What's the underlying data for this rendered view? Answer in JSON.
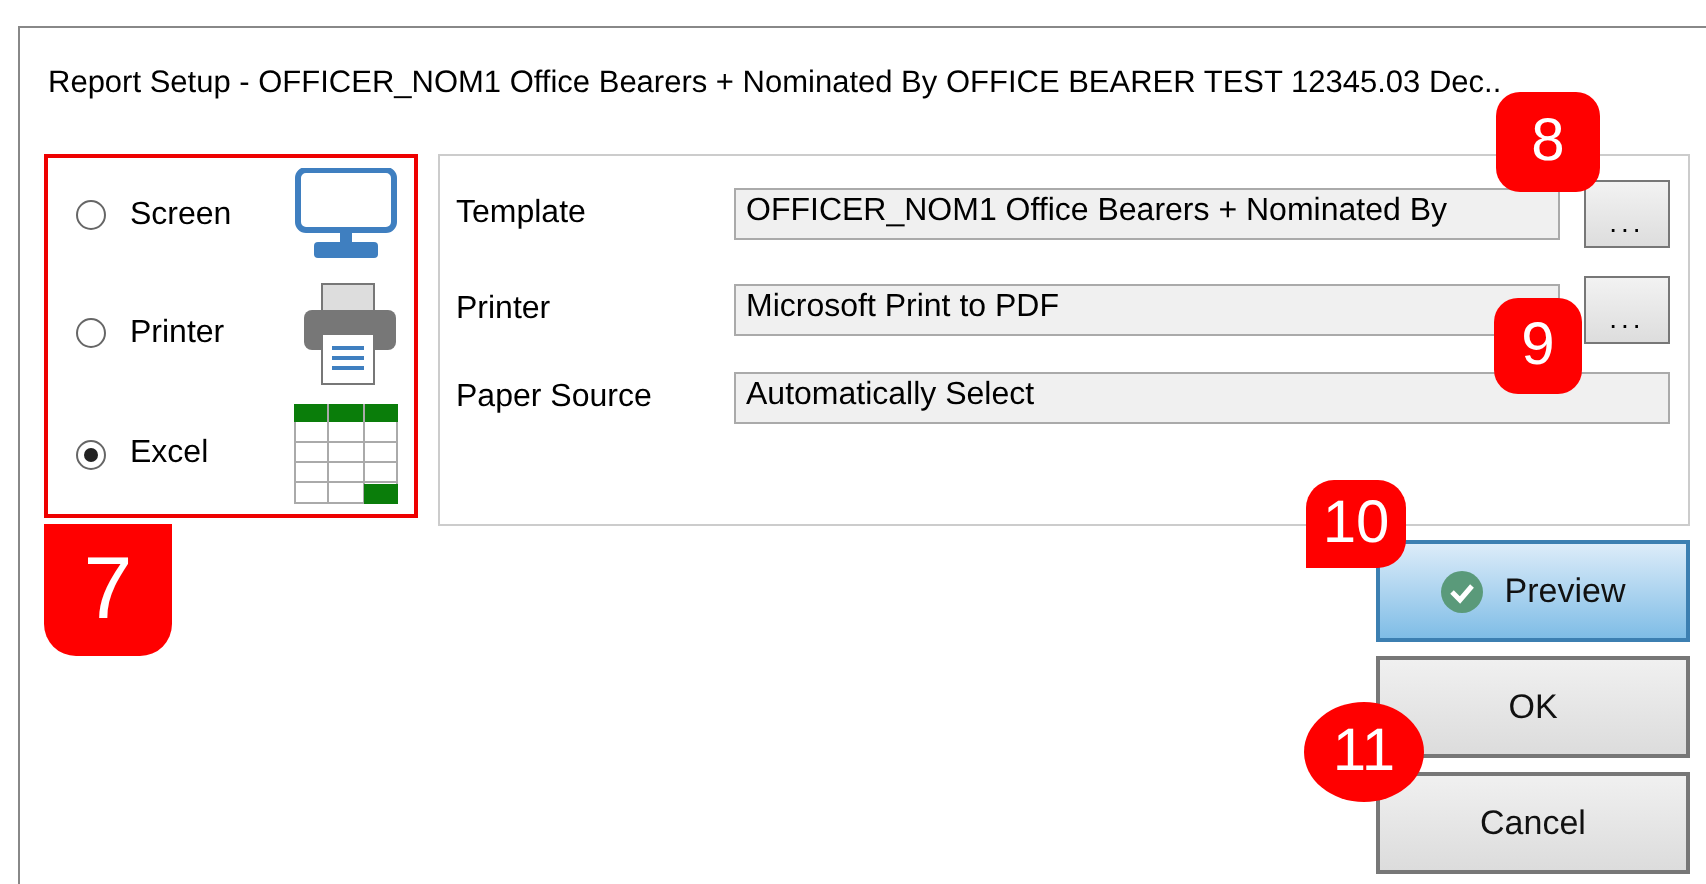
{
  "window": {
    "title": "Report Setup - OFFICER_NOM1 Office Bearers + Nominated By OFFICE BEARER TEST 12345.03 Dec.."
  },
  "outputs": [
    {
      "label": "Screen",
      "kind": "screen",
      "selected": false
    },
    {
      "label": "Printer",
      "kind": "printer",
      "selected": false
    },
    {
      "label": "Excel",
      "kind": "excel",
      "selected": true
    }
  ],
  "fields": [
    {
      "label": "Template",
      "value": "OFFICER_NOM1 Office Bearers + Nominated By",
      "browse": "..."
    },
    {
      "label": "Printer",
      "value": "Microsoft Print to PDF",
      "browse": "..."
    },
    {
      "label": "Paper Source",
      "value": "Automatically Select"
    }
  ],
  "buttons": [
    {
      "label": "Preview",
      "kind": "primary"
    },
    {
      "label": "OK",
      "kind": "normal"
    },
    {
      "label": "Cancel",
      "kind": "normal"
    }
  ],
  "callouts": [
    "7",
    "8",
    "9",
    "10",
    "11"
  ]
}
